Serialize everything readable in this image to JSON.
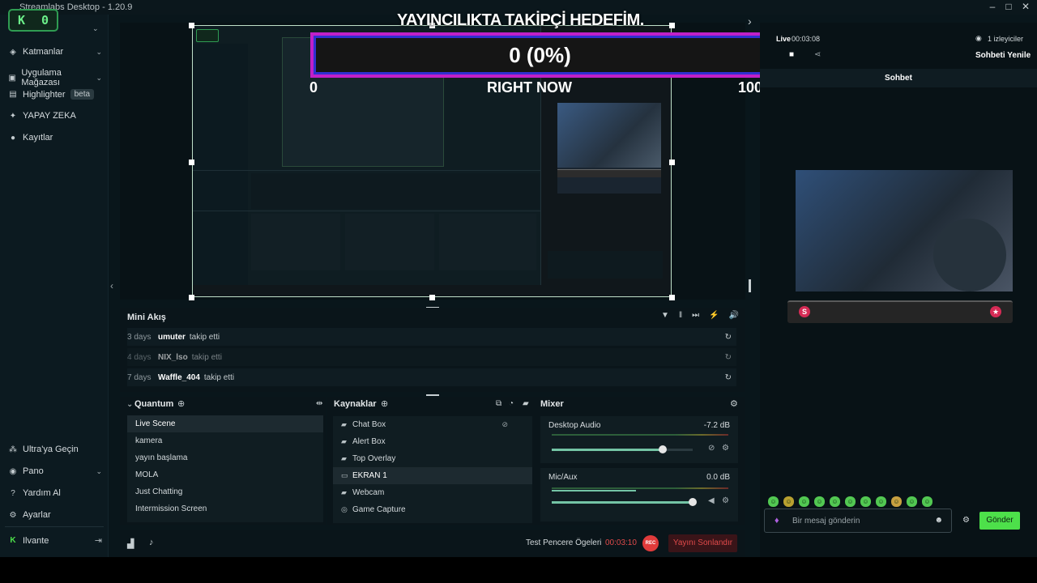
{
  "window": {
    "title": "Streamlabs Desktop - 1.20.9"
  },
  "brand_badge": {
    "text": "0"
  },
  "sidebar": {
    "items": [
      {
        "label": "Katmanlar",
        "icon": "layers-icon"
      },
      {
        "label": "Uygulama Mağazası",
        "icon": "store-icon"
      },
      {
        "label": "Highlighter",
        "badge": "beta",
        "icon": "highlighter-icon"
      },
      {
        "label": "YAPAY ZEKA",
        "icon": "ai-sparkle-icon"
      },
      {
        "label": "Kayıtlar",
        "icon": "record-icon"
      }
    ],
    "bottom_items": [
      {
        "label": "Ultra'ya Geçin",
        "icon": "ultra-icon"
      },
      {
        "label": "Pano",
        "icon": "dashboard-icon"
      },
      {
        "label": "Yardım Al",
        "icon": "help-icon"
      },
      {
        "label": "Ayarlar",
        "icon": "gear-icon"
      }
    ],
    "user": "Ilvante"
  },
  "goal_overlay": {
    "title": "YAYINCILIKTA TAKİPÇİ HEDEFİM.",
    "value": "0 (0%)",
    "min": "0",
    "max": "100",
    "subtitle": "RIGHT NOW",
    "progress_percent": 0
  },
  "mini_feed": {
    "title": "Mini Akış",
    "events": [
      {
        "age": "3 days",
        "user": "umuter",
        "action": "takip etti"
      },
      {
        "age": "4 days",
        "user": "NIX_lso",
        "action": "takip etti"
      },
      {
        "age": "7 days",
        "user": "Waffle_404",
        "action": "takip etti"
      }
    ]
  },
  "scenes": {
    "title": "Quantum",
    "items": [
      "Live Scene",
      "kamera",
      "yayın başlama",
      "MOLA",
      "Just Chatting",
      "Intermission Screen"
    ],
    "selected": "Live Scene"
  },
  "sources": {
    "title": "Kaynaklar",
    "items": [
      {
        "label": "Chat Box",
        "icon": "folder-icon"
      },
      {
        "label": "Alert Box",
        "icon": "folder-icon"
      },
      {
        "label": "Top Overlay",
        "icon": "folder-icon"
      },
      {
        "label": "EKRAN 1",
        "icon": "monitor-icon"
      },
      {
        "label": "Webcam",
        "icon": "folder-icon"
      },
      {
        "label": "Game Capture",
        "icon": "gamepad-icon"
      }
    ],
    "selected": "EKRAN 1"
  },
  "mixer": {
    "title": "Mixer",
    "channels": [
      {
        "name": "Desktop Audio",
        "db": "-7.2 dB",
        "level": 0.79
      },
      {
        "name": "Mic/Aux",
        "db": "0.0 dB",
        "level": 1.0
      }
    ]
  },
  "footer": {
    "test_label": "Test Pencere Ögeleri",
    "timer": "00:03:10",
    "rec_label": "REC",
    "end_stream_label": "Yayını Sonlandır"
  },
  "right_panel": {
    "live_label": "Live",
    "live_time": "00:03:08",
    "viewers": "1 izleyiciler",
    "refresh_chat": "Sohbeti Yenile",
    "chat_title": "Sohbet",
    "message_placeholder": "Bir mesaj gönderin",
    "send_label": "Gönder"
  },
  "colors": {
    "accent": "#31c86f",
    "goal_border": "#c020c8",
    "rec": "#e03b3b",
    "send": "#4de04a"
  }
}
